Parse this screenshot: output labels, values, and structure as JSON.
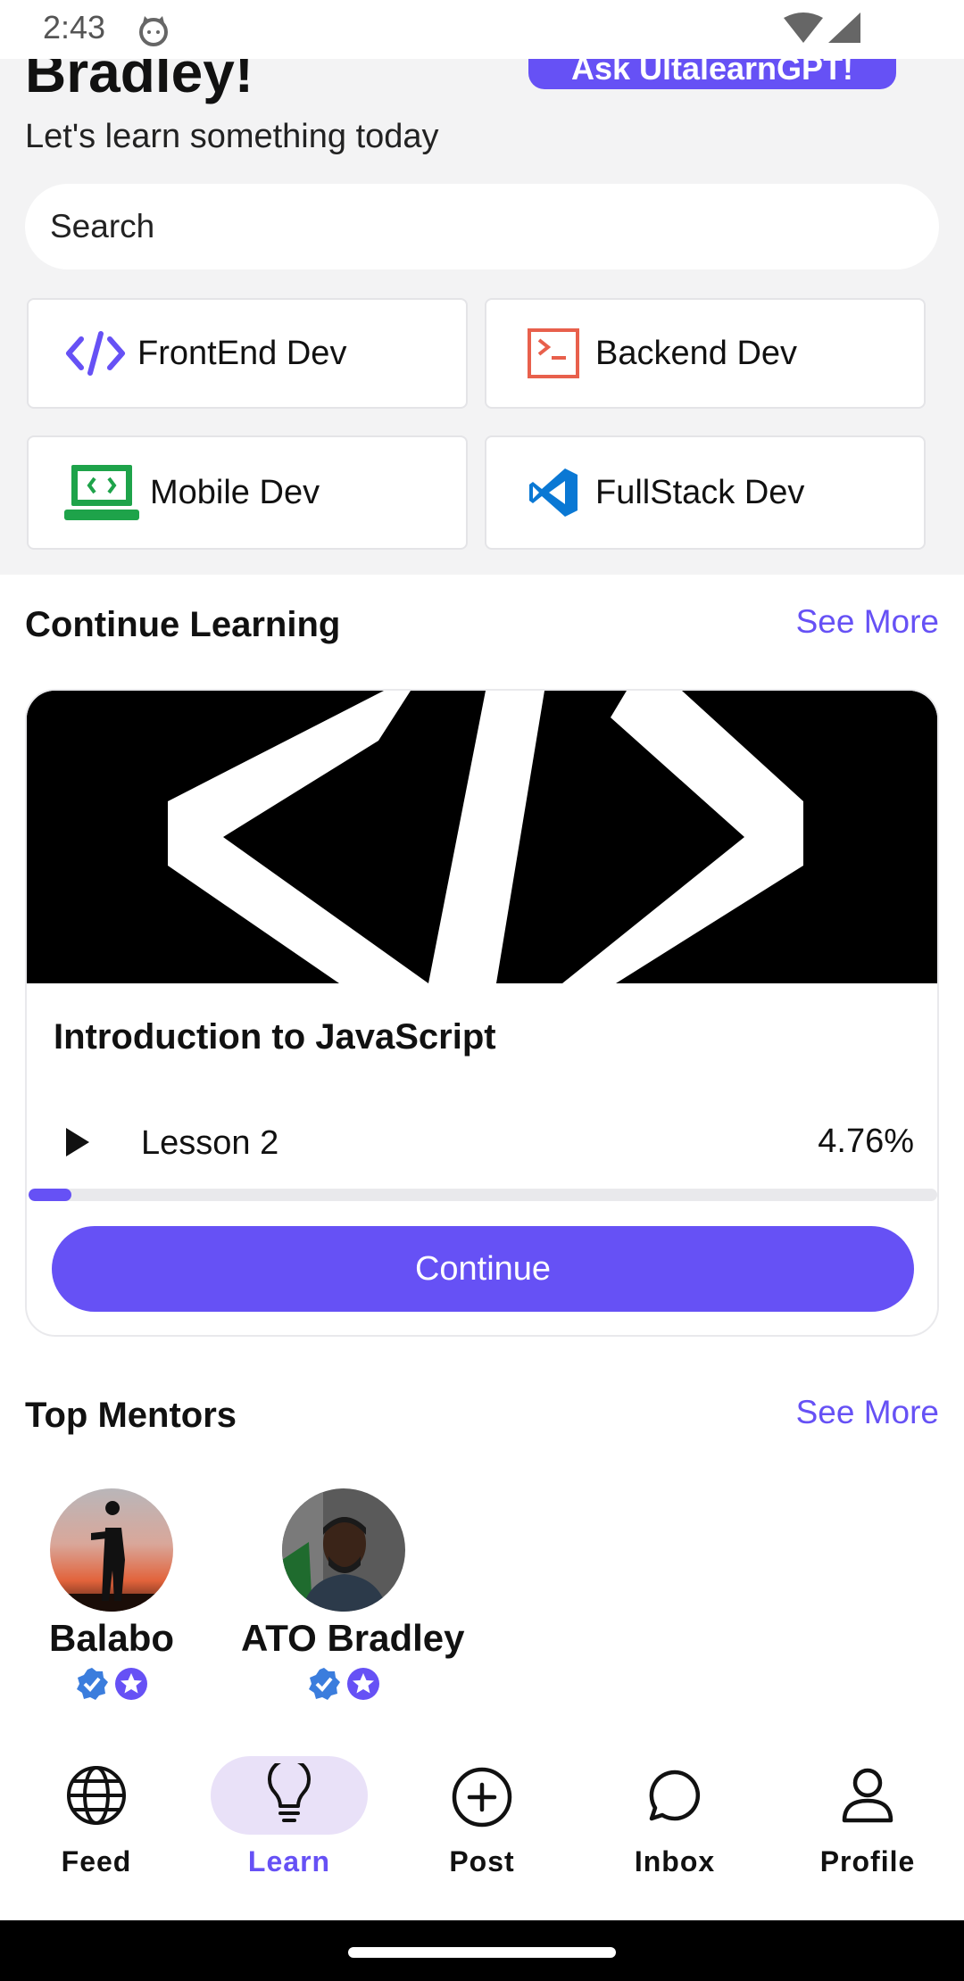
{
  "status_bar": {
    "time": "2:43"
  },
  "header": {
    "greeting_name": "Bradley!",
    "ask_button": "Ask UltalearnGPT!",
    "subtitle": "Let's learn something today"
  },
  "search": {
    "placeholder": "Search"
  },
  "categories": [
    {
      "label": "FrontEnd Dev",
      "icon": "code-icon",
      "color": "#6651f5"
    },
    {
      "label": "Backend Dev",
      "icon": "terminal-icon",
      "color": "#e8604c"
    },
    {
      "label": "Mobile Dev",
      "icon": "laptop-code-icon",
      "color": "#1ea34a"
    },
    {
      "label": "FullStack Dev",
      "icon": "vscode-icon",
      "color": "#0a78d4"
    }
  ],
  "continue_learning": {
    "title": "Continue Learning",
    "see_more": "See More",
    "course": {
      "title": "Introduction to JavaScript",
      "lesson": "Lesson 2",
      "progress_text": "4.76%",
      "progress": 0.0476,
      "button": "Continue"
    }
  },
  "top_mentors": {
    "title": "Top Mentors",
    "see_more": "See More",
    "mentors": [
      {
        "name": "Balabo",
        "badges": [
          "verified-badge-icon",
          "star-badge-icon"
        ]
      },
      {
        "name": "ATO Bradley",
        "badges": [
          "verified-badge-icon",
          "star-badge-icon"
        ]
      }
    ]
  },
  "nav": {
    "items": [
      {
        "label": "Feed",
        "icon": "globe-icon",
        "active": false
      },
      {
        "label": "Learn",
        "icon": "lightbulb-icon",
        "active": true
      },
      {
        "label": "Post",
        "icon": "plus-circle-icon",
        "active": false
      },
      {
        "label": "Inbox",
        "icon": "chat-bubble-icon",
        "active": false
      },
      {
        "label": "Profile",
        "icon": "person-icon",
        "active": false
      }
    ]
  },
  "colors": {
    "accent": "#6651f5",
    "active_pill": "#e9e1f8",
    "top_bg": "#f3f3f4"
  }
}
